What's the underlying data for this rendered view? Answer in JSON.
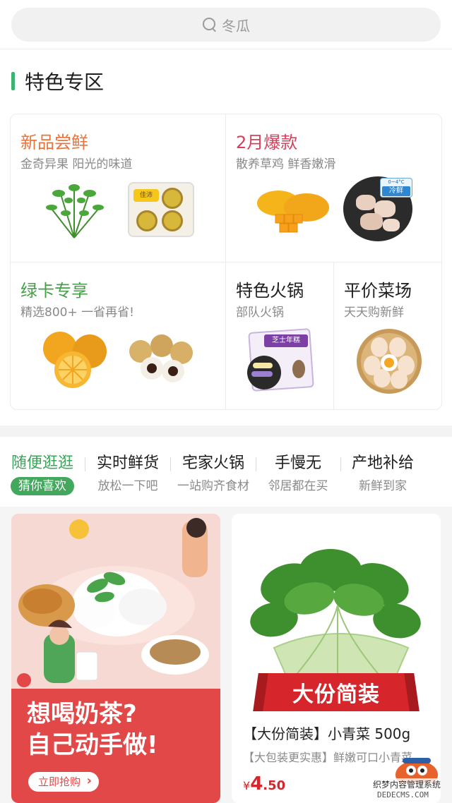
{
  "search": {
    "placeholder": "冬瓜"
  },
  "section": {
    "title": "特色专区"
  },
  "feature_grid": [
    {
      "title": "新品尝鲜",
      "subtitle": "金奇异果 阳光的味道"
    },
    {
      "title": "2月爆款",
      "subtitle": "散养草鸡 鲜香嫩滑"
    },
    {
      "title": "绿卡专享",
      "subtitle": "精选800+ 一省再省!"
    },
    {
      "title": "特色火锅",
      "subtitle": "部队火锅"
    },
    {
      "title": "平价菜场",
      "subtitle": "天天购新鲜"
    }
  ],
  "product_labels": {
    "kiwi_box_label": "佳沛",
    "chicken_tag": "冷鲜",
    "chicken_temp": "0~4°C",
    "bag_label": "芝士年糕"
  },
  "tabs": [
    {
      "title": "随便逛逛",
      "subtitle": "猜你喜欢",
      "active": true
    },
    {
      "title": "实时鲜货",
      "subtitle": "放松一下吧"
    },
    {
      "title": "宅家火锅",
      "subtitle": "一站购齐食材"
    },
    {
      "title": "手慢无",
      "subtitle": "邻居都在买"
    },
    {
      "title": "产地补给",
      "subtitle": "新鲜到家"
    }
  ],
  "banner": {
    "headline_1": "想喝奶茶?",
    "headline_2": "自己动手做!",
    "cta": "立即抢购"
  },
  "product": {
    "ribbon": "大份简装",
    "name": "【大份简装】小青菜 500g",
    "desc": "【大包装更实惠】鲜嫩可口小青菜",
    "price_symbol": "¥",
    "price_int": "4",
    "price_dec": ".50"
  },
  "watermark": {
    "line1": "织梦内容管理系统",
    "line2": "DEDECMS.COM"
  },
  "colors": {
    "accent_green": "#43a85d",
    "price_red": "#d7262b",
    "banner_red": "#e34848"
  }
}
